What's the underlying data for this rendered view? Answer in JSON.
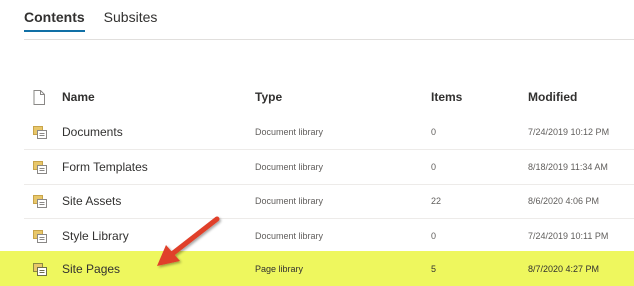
{
  "tabs": [
    {
      "label": "Contents"
    },
    {
      "label": "Subsites"
    }
  ],
  "columns": {
    "name": "Name",
    "type": "Type",
    "items": "Items",
    "modified": "Modified"
  },
  "rows": [
    {
      "name": "Documents",
      "type": "Document library",
      "items": "0",
      "modified": "7/24/2019 10:12 PM"
    },
    {
      "name": "Form Templates",
      "type": "Document library",
      "items": "0",
      "modified": "8/18/2019 11:34 AM"
    },
    {
      "name": "Site Assets",
      "type": "Document library",
      "items": "22",
      "modified": "8/6/2020 4:06 PM"
    },
    {
      "name": "Style Library",
      "type": "Document library",
      "items": "0",
      "modified": "7/24/2019 10:11 PM"
    },
    {
      "name": "Site Pages",
      "type": "Page library",
      "items": "5",
      "modified": "8/7/2020 4:27 PM"
    }
  ],
  "icons": {
    "header": "document-icon",
    "row": "library-icon"
  },
  "colors": {
    "accent": "#1170a6",
    "highlight": "#eef75e",
    "arrow": "#e0412c",
    "library_icon": "#c8a44a"
  }
}
